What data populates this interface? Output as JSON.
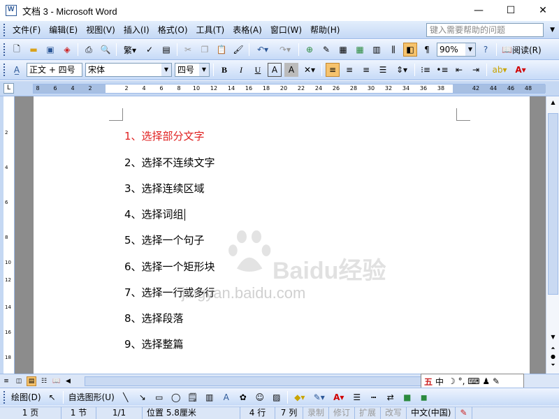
{
  "window": {
    "title": "文档 3 - Microsoft Word",
    "minimize": "—",
    "maximize": "☐",
    "close": "✕"
  },
  "menubar": {
    "items": [
      "文件(F)",
      "编辑(E)",
      "视图(V)",
      "插入(I)",
      "格式(O)",
      "工具(T)",
      "表格(A)",
      "窗口(W)",
      "帮助(H)"
    ],
    "help_placeholder": "键入需要帮助的问题"
  },
  "standard_toolbar": {
    "zoom": "90%",
    "read_label": "阅读(R)"
  },
  "format_toolbar": {
    "style": "正文 + 四号",
    "font": "宋体",
    "size": "四号",
    "bold": "B",
    "italic": "I",
    "underline": "U"
  },
  "ruler": {
    "ticks": [
      "8",
      "6",
      "4",
      "2",
      "2",
      "4",
      "6",
      "8",
      "10",
      "12",
      "14",
      "16",
      "18",
      "20",
      "22",
      "24",
      "26",
      "28",
      "30",
      "32",
      "34",
      "36",
      "38",
      "42",
      "44",
      "46",
      "48"
    ]
  },
  "vruler": {
    "ticks": [
      "2",
      "4",
      "6",
      "8",
      "10",
      "12",
      "14",
      "16",
      "18"
    ]
  },
  "document": {
    "lines": [
      {
        "text": "1、选择部分文字",
        "highlight": true
      },
      {
        "text": "2、选择不连续文字",
        "highlight": false
      },
      {
        "text": "3、选择连续区域",
        "highlight": false
      },
      {
        "text": "4、选择词组",
        "highlight": false
      },
      {
        "text": "5、选择一个句子",
        "highlight": false
      },
      {
        "text": "6、选择一个矩形块",
        "highlight": false
      },
      {
        "text": "7、选择一行或多行",
        "highlight": false
      },
      {
        "text": "8、选择段落",
        "highlight": false
      },
      {
        "text": "9、选择整篇",
        "highlight": false
      }
    ],
    "highlight_color": "#e02020"
  },
  "watermark": {
    "brand": "Baidu经验",
    "url": "jingyan.baidu.com"
  },
  "ime": {
    "mode": "中",
    "icons": "☽ °, ⌨ ♟ ✎"
  },
  "drawbar": {
    "draw_label": "绘图(D)",
    "autoshape_label": "自选图形(U)"
  },
  "statusbar": {
    "page": "1 页",
    "section": "1 节",
    "pages": "1/1",
    "position": "位置 5.8厘米",
    "line": "4 行",
    "column": "7 列",
    "rec": "录制",
    "trk": "修订",
    "ext": "扩展",
    "ovr": "改写",
    "lang": "中文(中国)"
  }
}
